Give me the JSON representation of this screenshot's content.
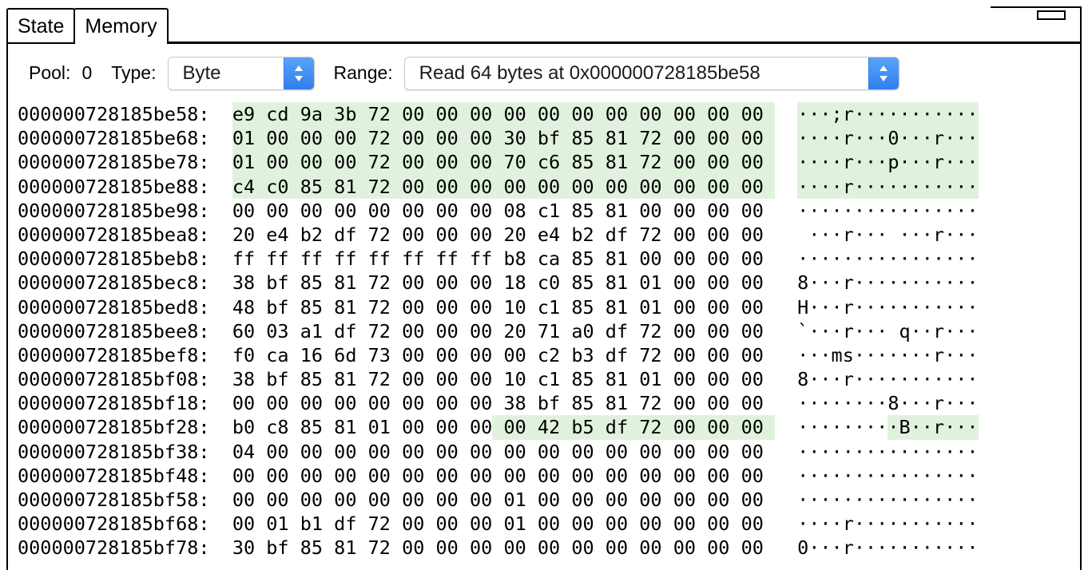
{
  "window": {
    "minimize_icon": "minimize-icon"
  },
  "tabs": [
    {
      "label": "State",
      "active": false
    },
    {
      "label": "Memory",
      "active": true
    }
  ],
  "toolbar": {
    "pool_label": "Pool:",
    "pool_value": "0",
    "type_label": "Type:",
    "type_value": "Byte",
    "range_label": "Range:",
    "range_value": "Read 64 bytes at 0x000000728185be58",
    "stepper_icon": "chevron-up-down-icon"
  },
  "colors": {
    "highlight": "#e0f2dd",
    "stepper_blue": "#3b82f6",
    "text": "#000000",
    "background": "#ffffff"
  },
  "hexdump": {
    "bytes_per_row": 16,
    "rows": [
      {
        "address": "000000728185be58",
        "bytes": [
          "e9",
          "cd",
          "9a",
          "3b",
          "72",
          "00",
          "00",
          "00",
          "00",
          "00",
          "00",
          "00",
          "00",
          "00",
          "00",
          "00"
        ],
        "ascii": [
          "·",
          "·",
          "·",
          ";",
          "r",
          "·",
          "·",
          "·",
          "·",
          "·",
          "·",
          "·",
          "·",
          "·",
          "·",
          "·"
        ],
        "highlight": [
          0,
          16
        ]
      },
      {
        "address": "000000728185be68",
        "bytes": [
          "01",
          "00",
          "00",
          "00",
          "72",
          "00",
          "00",
          "00",
          "30",
          "bf",
          "85",
          "81",
          "72",
          "00",
          "00",
          "00"
        ],
        "ascii": [
          "·",
          "·",
          "·",
          "·",
          "r",
          "·",
          "·",
          "·",
          "0",
          "·",
          "·",
          "·",
          "r",
          "·",
          "·",
          "·"
        ],
        "highlight": [
          0,
          16
        ]
      },
      {
        "address": "000000728185be78",
        "bytes": [
          "01",
          "00",
          "00",
          "00",
          "72",
          "00",
          "00",
          "00",
          "70",
          "c6",
          "85",
          "81",
          "72",
          "00",
          "00",
          "00"
        ],
        "ascii": [
          "·",
          "·",
          "·",
          "·",
          "r",
          "·",
          "·",
          "·",
          "p",
          "·",
          "·",
          "·",
          "r",
          "·",
          "·",
          "·"
        ],
        "highlight": [
          0,
          16
        ]
      },
      {
        "address": "000000728185be88",
        "bytes": [
          "c4",
          "c0",
          "85",
          "81",
          "72",
          "00",
          "00",
          "00",
          "00",
          "00",
          "00",
          "00",
          "00",
          "00",
          "00",
          "00"
        ],
        "ascii": [
          "·",
          "·",
          "·",
          "·",
          "r",
          "·",
          "·",
          "·",
          "·",
          "·",
          "·",
          "·",
          "·",
          "·",
          "·",
          "·"
        ],
        "highlight": [
          0,
          16
        ]
      },
      {
        "address": "000000728185be98",
        "bytes": [
          "00",
          "00",
          "00",
          "00",
          "00",
          "00",
          "00",
          "00",
          "08",
          "c1",
          "85",
          "81",
          "00",
          "00",
          "00",
          "00"
        ],
        "ascii": [
          "·",
          "·",
          "·",
          "·",
          "·",
          "·",
          "·",
          "·",
          "·",
          "·",
          "·",
          "·",
          "·",
          "·",
          "·",
          "·"
        ],
        "highlight": null
      },
      {
        "address": "000000728185bea8",
        "bytes": [
          "20",
          "e4",
          "b2",
          "df",
          "72",
          "00",
          "00",
          "00",
          "20",
          "e4",
          "b2",
          "df",
          "72",
          "00",
          "00",
          "00"
        ],
        "ascii": [
          " ",
          "·",
          "·",
          "·",
          "r",
          "·",
          "·",
          "·",
          " ",
          "·",
          "·",
          "·",
          "r",
          "·",
          "·",
          "·"
        ],
        "highlight": null
      },
      {
        "address": "000000728185beb8",
        "bytes": [
          "ff",
          "ff",
          "ff",
          "ff",
          "ff",
          "ff",
          "ff",
          "ff",
          "b8",
          "ca",
          "85",
          "81",
          "00",
          "00",
          "00",
          "00"
        ],
        "ascii": [
          "·",
          "·",
          "·",
          "·",
          "·",
          "·",
          "·",
          "·",
          "·",
          "·",
          "·",
          "·",
          "·",
          "·",
          "·",
          "·"
        ],
        "highlight": null
      },
      {
        "address": "000000728185bec8",
        "bytes": [
          "38",
          "bf",
          "85",
          "81",
          "72",
          "00",
          "00",
          "00",
          "18",
          "c0",
          "85",
          "81",
          "01",
          "00",
          "00",
          "00"
        ],
        "ascii": [
          "8",
          "·",
          "·",
          "·",
          "r",
          "·",
          "·",
          "·",
          "·",
          "·",
          "·",
          "·",
          "·",
          "·",
          "·",
          "·"
        ],
        "highlight": null
      },
      {
        "address": "000000728185bed8",
        "bytes": [
          "48",
          "bf",
          "85",
          "81",
          "72",
          "00",
          "00",
          "00",
          "10",
          "c1",
          "85",
          "81",
          "01",
          "00",
          "00",
          "00"
        ],
        "ascii": [
          "H",
          "·",
          "·",
          "·",
          "r",
          "·",
          "·",
          "·",
          "·",
          "·",
          "·",
          "·",
          "·",
          "·",
          "·",
          "·"
        ],
        "highlight": null
      },
      {
        "address": "000000728185bee8",
        "bytes": [
          "60",
          "03",
          "a1",
          "df",
          "72",
          "00",
          "00",
          "00",
          "20",
          "71",
          "a0",
          "df",
          "72",
          "00",
          "00",
          "00"
        ],
        "ascii": [
          "`",
          "·",
          "·",
          "·",
          "r",
          "·",
          "·",
          "·",
          " ",
          "q",
          "·",
          "·",
          "r",
          "·",
          "·",
          "·"
        ],
        "highlight": null
      },
      {
        "address": "000000728185bef8",
        "bytes": [
          "f0",
          "ca",
          "16",
          "6d",
          "73",
          "00",
          "00",
          "00",
          "00",
          "c2",
          "b3",
          "df",
          "72",
          "00",
          "00",
          "00"
        ],
        "ascii": [
          "·",
          "·",
          "·",
          "m",
          "s",
          "·",
          "·",
          "·",
          "·",
          "·",
          "·",
          "·",
          "r",
          "·",
          "·",
          "·"
        ],
        "highlight": null
      },
      {
        "address": "000000728185bf08",
        "bytes": [
          "38",
          "bf",
          "85",
          "81",
          "72",
          "00",
          "00",
          "00",
          "10",
          "c1",
          "85",
          "81",
          "01",
          "00",
          "00",
          "00"
        ],
        "ascii": [
          "8",
          "·",
          "·",
          "·",
          "r",
          "·",
          "·",
          "·",
          "·",
          "·",
          "·",
          "·",
          "·",
          "·",
          "·",
          "·"
        ],
        "highlight": null
      },
      {
        "address": "000000728185bf18",
        "bytes": [
          "00",
          "00",
          "00",
          "00",
          "00",
          "00",
          "00",
          "00",
          "38",
          "bf",
          "85",
          "81",
          "72",
          "00",
          "00",
          "00"
        ],
        "ascii": [
          "·",
          "·",
          "·",
          "·",
          "·",
          "·",
          "·",
          "·",
          "8",
          "·",
          "·",
          "·",
          "r",
          "·",
          "·",
          "·"
        ],
        "highlight": null
      },
      {
        "address": "000000728185bf28",
        "bytes": [
          "b0",
          "c8",
          "85",
          "81",
          "01",
          "00",
          "00",
          "00",
          "00",
          "42",
          "b5",
          "df",
          "72",
          "00",
          "00",
          "00"
        ],
        "ascii": [
          "·",
          "·",
          "·",
          "·",
          "·",
          "·",
          "·",
          "·",
          "·",
          "B",
          "·",
          "·",
          "r",
          "·",
          "·",
          "·"
        ],
        "highlight": [
          8,
          16
        ]
      },
      {
        "address": "000000728185bf38",
        "bytes": [
          "04",
          "00",
          "00",
          "00",
          "00",
          "00",
          "00",
          "00",
          "00",
          "00",
          "00",
          "00",
          "00",
          "00",
          "00",
          "00"
        ],
        "ascii": [
          "·",
          "·",
          "·",
          "·",
          "·",
          "·",
          "·",
          "·",
          "·",
          "·",
          "·",
          "·",
          "·",
          "·",
          "·",
          "·"
        ],
        "highlight": null
      },
      {
        "address": "000000728185bf48",
        "bytes": [
          "00",
          "00",
          "00",
          "00",
          "00",
          "00",
          "00",
          "00",
          "00",
          "00",
          "00",
          "00",
          "00",
          "00",
          "00",
          "00"
        ],
        "ascii": [
          "·",
          "·",
          "·",
          "·",
          "·",
          "·",
          "·",
          "·",
          "·",
          "·",
          "·",
          "·",
          "·",
          "·",
          "·",
          "·"
        ],
        "highlight": null
      },
      {
        "address": "000000728185bf58",
        "bytes": [
          "00",
          "00",
          "00",
          "00",
          "00",
          "00",
          "00",
          "00",
          "01",
          "00",
          "00",
          "00",
          "00",
          "00",
          "00",
          "00"
        ],
        "ascii": [
          "·",
          "·",
          "·",
          "·",
          "·",
          "·",
          "·",
          "·",
          "·",
          "·",
          "·",
          "·",
          "·",
          "·",
          "·",
          "·"
        ],
        "highlight": null
      },
      {
        "address": "000000728185bf68",
        "bytes": [
          "00",
          "01",
          "b1",
          "df",
          "72",
          "00",
          "00",
          "00",
          "01",
          "00",
          "00",
          "00",
          "00",
          "00",
          "00",
          "00"
        ],
        "ascii": [
          "·",
          "·",
          "·",
          "·",
          "r",
          "·",
          "·",
          "·",
          "·",
          "·",
          "·",
          "·",
          "·",
          "·",
          "·",
          "·"
        ],
        "highlight": null
      },
      {
        "address": "000000728185bf78",
        "bytes": [
          "30",
          "bf",
          "85",
          "81",
          "72",
          "00",
          "00",
          "00",
          "00",
          "00",
          "00",
          "00",
          "00",
          "00",
          "00",
          "00"
        ],
        "ascii": [
          "0",
          "·",
          "·",
          "·",
          "r",
          "·",
          "·",
          "·",
          "·",
          "·",
          "·",
          "·",
          "·",
          "·",
          "·",
          "·"
        ],
        "highlight": null
      }
    ]
  }
}
